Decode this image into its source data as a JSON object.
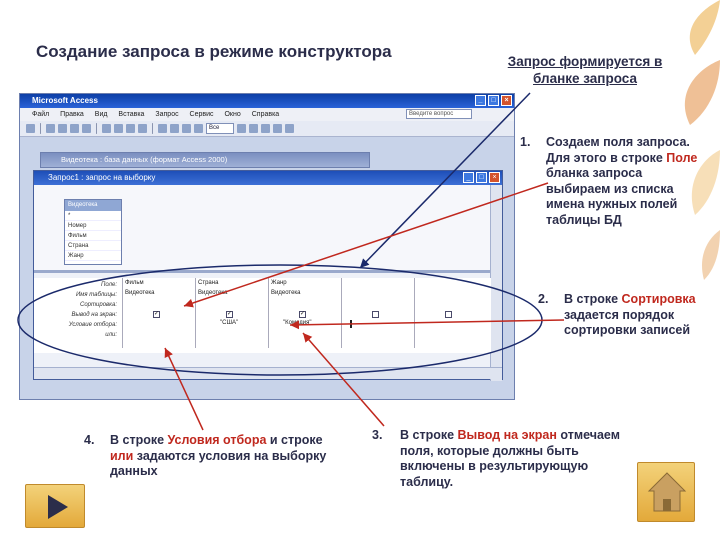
{
  "slide": {
    "title": "Создание запроса в режиме конструктора",
    "side_title": "Запрос формируется в бланке запроса"
  },
  "app": {
    "title": "Microsoft Access",
    "menu": [
      "Файл",
      "Правка",
      "Вид",
      "Вставка",
      "Запрос",
      "Сервис",
      "Окно",
      "Справка"
    ],
    "help_placeholder": "Введите вопрос",
    "toolbar_combo": "Все",
    "db_window_title": "Видеотека : база данных (формат Access 2000)",
    "query_window_title": "Запрос1 : запрос на выборку",
    "table": {
      "name": "Видеотека",
      "fields": [
        "*",
        "Номер",
        "Фильм",
        "Страна",
        "Жанр"
      ]
    },
    "grid": {
      "row_labels": [
        "Поле:",
        "Имя таблицы:",
        "Сортировка:",
        "Вывод на экран:",
        "Условие отбора:",
        "или:"
      ],
      "columns": [
        {
          "field": "Фильм",
          "table": "Видеотека",
          "show": true,
          "criteria": ""
        },
        {
          "field": "Страна",
          "table": "Видеотека",
          "show": true,
          "criteria": "\"США\""
        },
        {
          "field": "Жанр",
          "table": "Видеотека",
          "show": true,
          "criteria": "\"Комедия\""
        },
        {
          "field": "",
          "table": "",
          "show": false,
          "criteria": ""
        },
        {
          "field": "",
          "table": "",
          "show": false,
          "criteria": ""
        }
      ]
    }
  },
  "notes": [
    {
      "num": "1.",
      "parts": [
        "Создаем поля запроса. Для этого в строке ",
        "Поле",
        " бланка запроса выбираем из списка имена нужных полей таблицы БД"
      ]
    },
    {
      "num": "2.",
      "parts": [
        "В строке ",
        "Сортировка",
        " задается порядок сортировки записей"
      ]
    },
    {
      "num": "3.",
      "parts": [
        "В строке ",
        "Вывод на экран",
        " отмечаем поля, которые должны быть включены в результирующую таблицу."
      ]
    },
    {
      "num": "4.",
      "parts": [
        "В строке ",
        "Условия отбора",
        " и строке ",
        "или",
        " задаются условия на выборку данных"
      ]
    }
  ],
  "colors": {
    "accent_red": "#c0281e",
    "title": "#2b2d4a",
    "button": "#e3a93a"
  },
  "icons": {
    "next": "play-arrow-icon",
    "home": "home-icon"
  }
}
